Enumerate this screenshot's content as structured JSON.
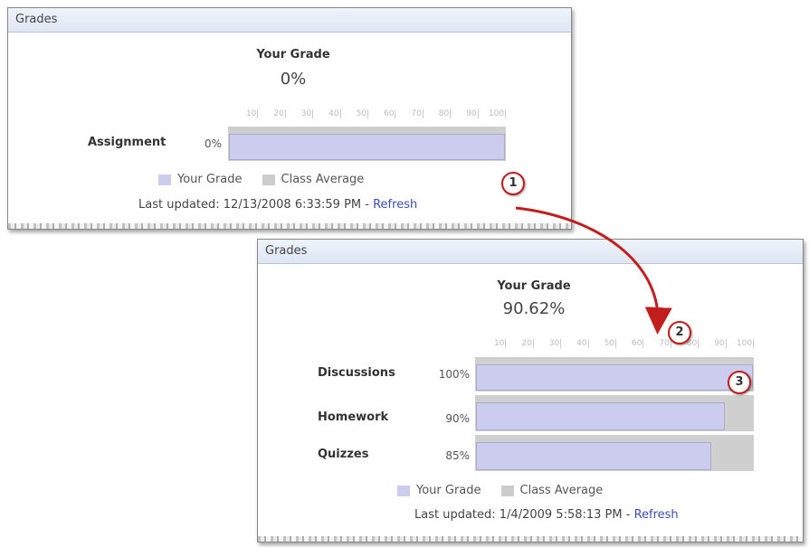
{
  "panel1": {
    "title": "Grades",
    "your_grade_label": "Your Grade",
    "your_grade_value": "0%",
    "ticks": [
      "10",
      "20",
      "30",
      "40",
      "50",
      "60",
      "70",
      "80",
      "90",
      "100"
    ],
    "rows": [
      {
        "label": "Assignment",
        "pct": "0%",
        "value": 0
      }
    ],
    "legend_you": "Your Grade",
    "legend_avg": "Class Average",
    "updated_text": "Last updated: 12/13/2008 6:33:59 PM -",
    "refresh": "Refresh"
  },
  "panel2": {
    "title": "Grades",
    "your_grade_label": "Your Grade",
    "your_grade_value": "90.62%",
    "ticks": [
      "10",
      "20",
      "30",
      "40",
      "50",
      "60",
      "70",
      "80",
      "90",
      "100"
    ],
    "rows": [
      {
        "label": "Discussions",
        "pct": "100%",
        "value": 100
      },
      {
        "label": "Homework",
        "pct": "90%",
        "value": 90
      },
      {
        "label": "Quizzes",
        "pct": "85%",
        "value": 85
      }
    ],
    "legend_you": "Your Grade",
    "legend_avg": "Class Average",
    "updated_text": "Last updated: 1/4/2009 5:58:13 PM -",
    "refresh": "Refresh"
  },
  "callouts": [
    "1",
    "2",
    "3"
  ],
  "colors": {
    "your_grade": "#ccccee",
    "class_average": "#cccccc",
    "callout": "#c21d1d",
    "link": "#3a4fb4"
  }
}
